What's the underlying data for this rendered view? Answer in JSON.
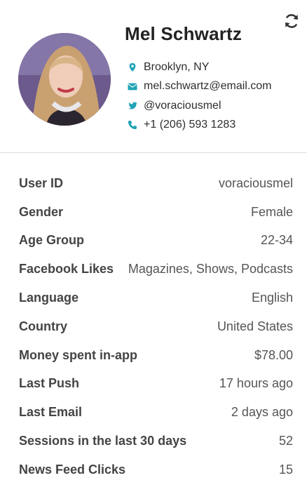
{
  "profile": {
    "name": "Mel Schwartz",
    "location": "Brooklyn, NY",
    "email": "mel.schwartz@email.com",
    "twitter": "@voraciousmel",
    "phone": "+1 (206) 593 1283"
  },
  "icons": {
    "refresh": "refresh-icon",
    "location": "map-pin-icon",
    "email": "envelope-icon",
    "twitter": "twitter-icon",
    "phone": "phone-icon"
  },
  "colors": {
    "accent": "#1fa3b6",
    "text": "#3d3d3d",
    "divider": "#dcdcdc"
  },
  "details": [
    {
      "label": "User ID",
      "value": "voraciousmel"
    },
    {
      "label": "Gender",
      "value": "Female"
    },
    {
      "label": "Age Group",
      "value": "22-34"
    },
    {
      "label": "Facebook Likes",
      "value": "Magazines, Shows, Podcasts"
    },
    {
      "label": "Language",
      "value": "English"
    },
    {
      "label": "Country",
      "value": "United States"
    },
    {
      "label": "Money spent in-app",
      "value": "$78.00"
    },
    {
      "label": "Last Push",
      "value": "17 hours ago"
    },
    {
      "label": "Last Email",
      "value": "2 days ago"
    },
    {
      "label": "Sessions in the last 30 days",
      "value": "52"
    },
    {
      "label": "News Feed Clicks",
      "value": "15"
    }
  ]
}
